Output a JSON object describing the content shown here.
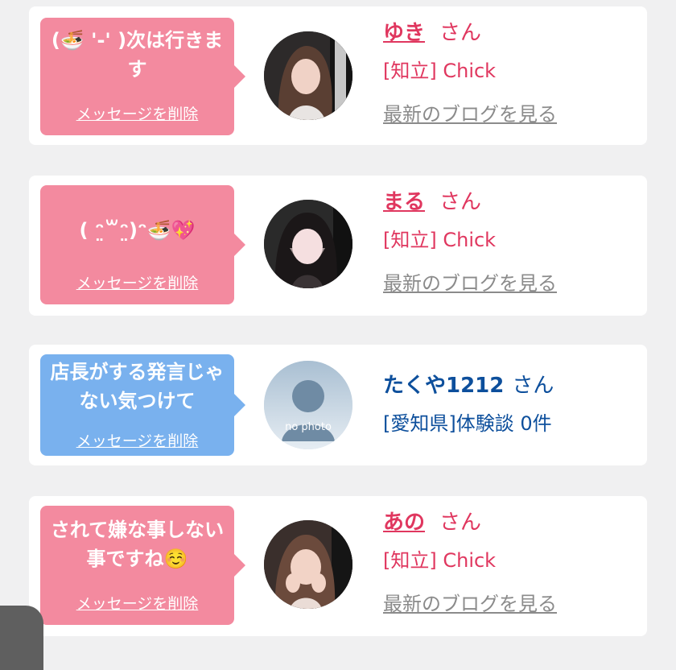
{
  "cards": [
    {
      "message": "(🍜 '-' )次は行きます",
      "delete_label": "メッセージを削除",
      "name": "ゆき",
      "honorific": "さん",
      "shop": "[知立] Chick",
      "blog_label": "最新のブログを見る",
      "avatar_icon": "profile-photo",
      "bubble_color": "#f38a9f"
    },
    {
      "message": "( ᵔ̤꒳ᵔ̤)ᵔ🍜💖",
      "delete_label": "メッセージを削除",
      "name": "まる",
      "honorific": "さん",
      "shop": "[知立] Chick",
      "blog_label": "最新のブログを見る",
      "avatar_icon": "profile-photo",
      "bubble_color": "#f38a9f"
    },
    {
      "message": "店長がする発言じゃない気つけて",
      "delete_label": "メッセージを削除",
      "name": "たくや1212",
      "honorific": "さん",
      "shop": "[愛知県]体験談 0件",
      "avatar_icon": "no-photo-silhouette",
      "avatar_text": "no photo",
      "bubble_color": "#79b1ee"
    },
    {
      "message": "されて嫌な事しない事ですね☺️",
      "delete_label": "メッセージを削除",
      "name": "あの",
      "honorific": "さん",
      "shop": "[知立] Chick",
      "blog_label": "最新のブログを見る",
      "avatar_icon": "profile-photo",
      "bubble_color": "#f38a9f"
    }
  ],
  "colors": {
    "accent_pink": "#e0375f",
    "accent_blue": "#0d4f9c",
    "link_gray": "#8b8b8b"
  }
}
